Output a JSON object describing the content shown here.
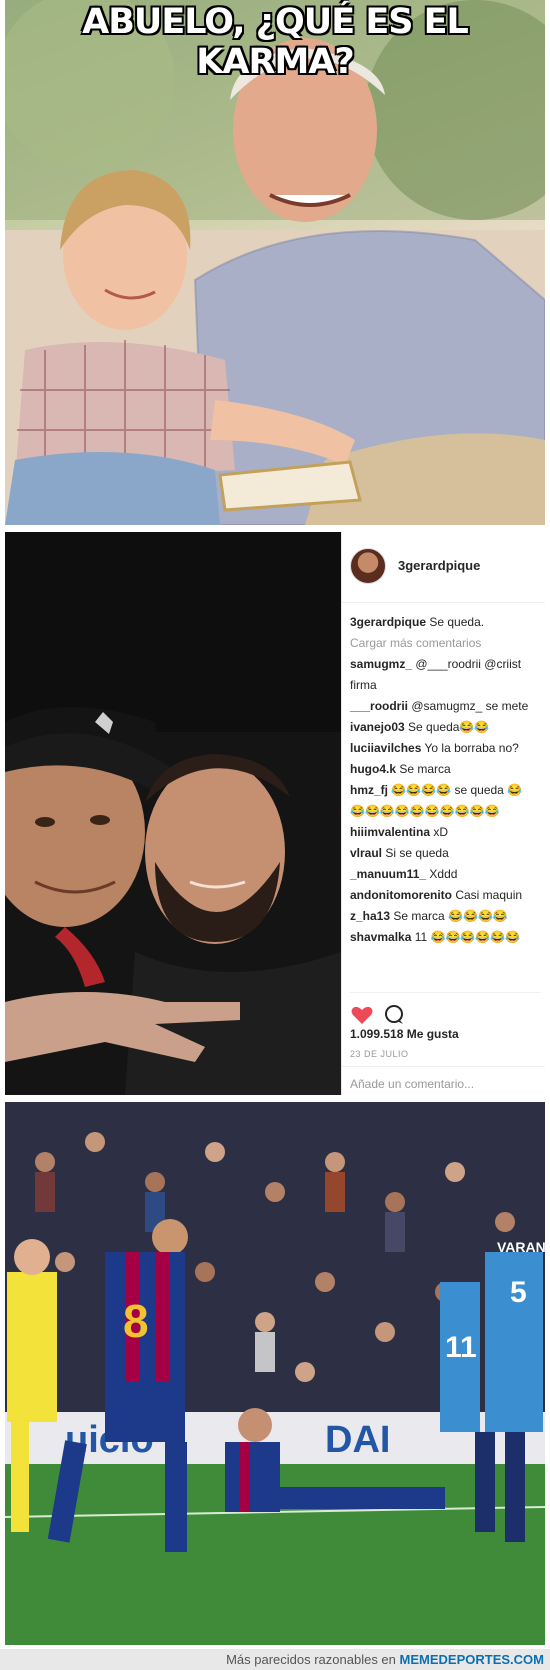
{
  "meme": {
    "title": "ABUELO, ¿QUÉ ES EL KARMA?"
  },
  "instagram": {
    "username": "3gerardpique",
    "caption_user": "3gerardpique",
    "caption_text": "Se queda.",
    "load_more": "Cargar más comentarios",
    "comments": [
      {
        "user": "samugmz_",
        "text": "@___roodrii @criist"
      },
      {
        "user": "",
        "text": "firma"
      },
      {
        "user": "___roodrii",
        "text": "@samugmz_ se mete"
      },
      {
        "user": "ivanejo03",
        "text": "Se queda😂😂"
      },
      {
        "user": "luciiavilches",
        "text": "Yo la borraba no?"
      },
      {
        "user": "hugo4.k",
        "text": "Se marca"
      },
      {
        "user": "hmz_fj",
        "text": "😂😂😂😂 se queda 😂"
      },
      {
        "user": "",
        "text": "😂😂😂😂😂😂😂😂😂😂"
      },
      {
        "user": "hiiimvalentina",
        "text": "xD"
      },
      {
        "user": "vlraul",
        "text": "Si se queda"
      },
      {
        "user": "_manuum11_",
        "text": "Xddd"
      },
      {
        "user": "andonitomorenito",
        "text": "Casi maquin"
      },
      {
        "user": "z_ha13",
        "text": "Se marca 😂😂😂😂"
      },
      {
        "user": "shavmalka",
        "text": "11 😂😂😂😂😂😂"
      }
    ],
    "likes": "1.099.518 Me gusta",
    "date": "23 DE JULIO",
    "add_comment_placeholder": "Añade un comentario..."
  },
  "stadium": {
    "banner_left": "uicio",
    "banner_right": "DAI",
    "jersey_number_left": "8",
    "jersey_number_right": "5",
    "jersey_name_right": "VARANE",
    "jersey_number_mid": "11"
  },
  "footer": {
    "prefix": "Más parecidos razonables en",
    "brand": "MEMEDEPORTES.COM"
  },
  "colors": {
    "instagram_heart": "#ed4956",
    "barca_blue": "#1d3a8a",
    "barca_red": "#a50044",
    "madrid_blue": "#3b8fd0",
    "keeper_yellow": "#f2e23a"
  }
}
